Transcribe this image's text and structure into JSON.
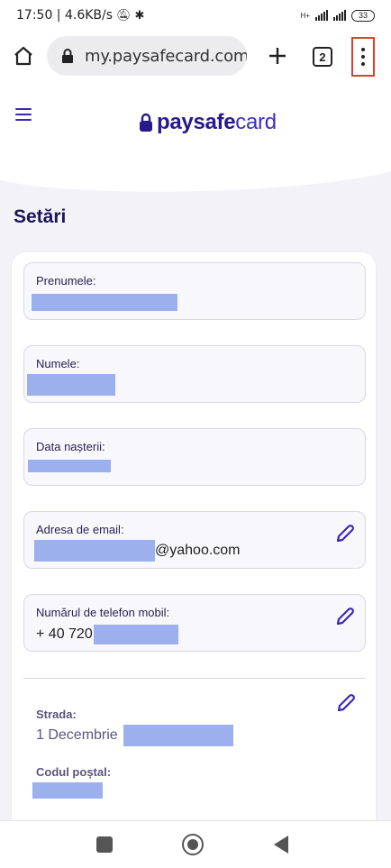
{
  "status_bar": {
    "time_speed": "17:50 | 4.6KB/s",
    "network_label": "H+",
    "battery": "33"
  },
  "browser": {
    "url": "my.paysafecard.com/",
    "tab_count": "2",
    "home_icon": "home-icon",
    "lock_icon": "lock-icon",
    "new_tab_icon": "plus-icon",
    "menu_icon": "more-vert-icon",
    "menu_highlight_color": "#d9402e"
  },
  "header": {
    "logo_bold": "paysafe",
    "logo_light": "card",
    "brand_color": "#261a8a",
    "menu_icon": "hamburger-icon"
  },
  "page": {
    "title": "Setări"
  },
  "fields": {
    "first_name": {
      "label": "Prenumele:"
    },
    "last_name": {
      "label": "Numele:"
    },
    "birth_date": {
      "label": "Data nașterii:"
    },
    "email": {
      "label": "Adresa de email:",
      "suffix": "@yahoo.com"
    },
    "phone": {
      "label": "Numărul de telefon mobil:",
      "prefix": "+ 40 720"
    }
  },
  "address": {
    "street_label": "Strada:",
    "street_value": "1 Decembrie",
    "postal_label": "Codul poștal:"
  },
  "colors": {
    "redaction": "#9cb0ee",
    "accent": "#3b27b5"
  }
}
